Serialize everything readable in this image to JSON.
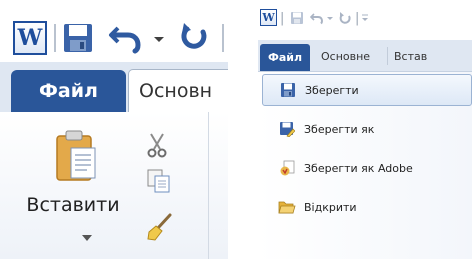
{
  "left_panel": {
    "app_icon_letter": "W",
    "file_tab": "Файл",
    "home_tab": "Основн",
    "paste_label": "Вставити"
  },
  "right_panel": {
    "app_icon_letter": "W",
    "file_tab": "Файл",
    "tabs": [
      "Основне",
      "Встав"
    ],
    "menu_items": [
      {
        "label": "Зберегти",
        "icon": "save-icon",
        "selected": true
      },
      {
        "label": "Зберегти як",
        "icon": "save-as-icon",
        "selected": false
      },
      {
        "label": "Зберегти як Adobe",
        "icon": "save-as-adobe-pdf-icon",
        "selected": false
      },
      {
        "label": "Відкрити",
        "icon": "open-folder-icon",
        "selected": false
      }
    ]
  },
  "colors": {
    "file_tab_blue": "#2a5699",
    "ribbon_tab_bg": "#dfe7f2",
    "selected_item_border": "#9bb3d3"
  }
}
